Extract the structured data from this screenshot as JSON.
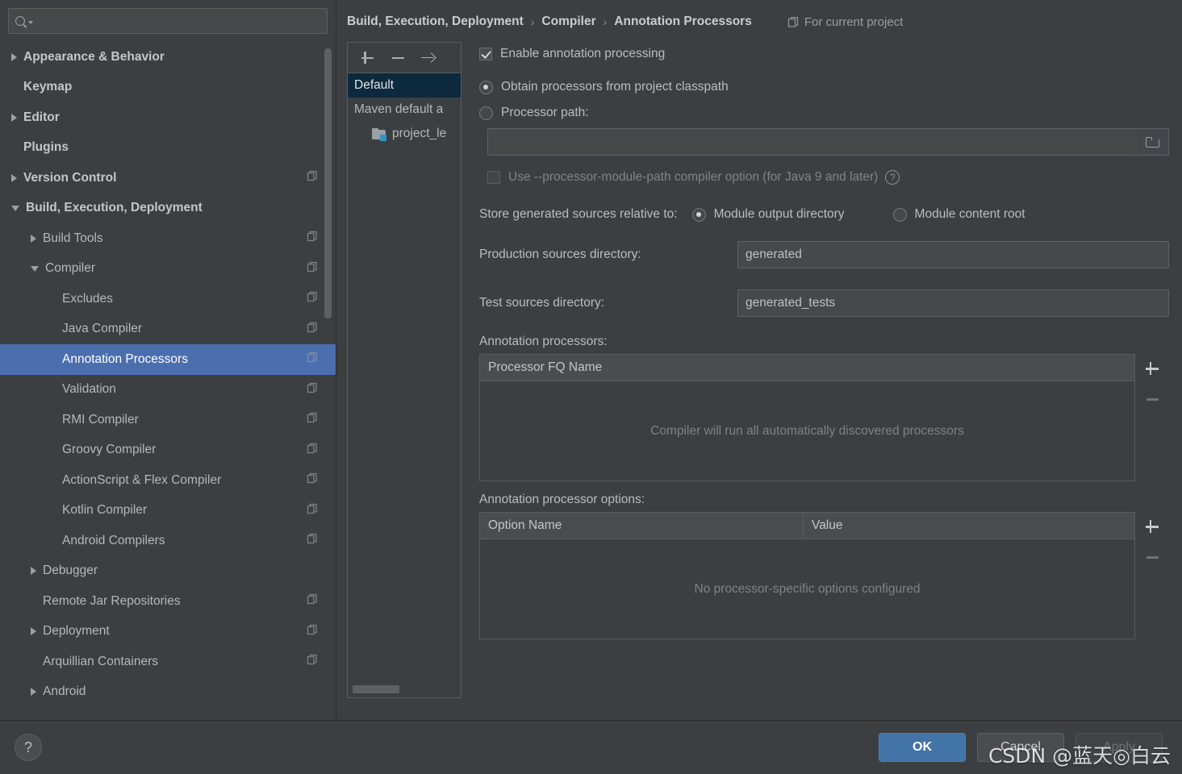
{
  "search": {
    "placeholder": "",
    "value": "",
    "icon": "search-icon"
  },
  "sidebar": {
    "items": [
      {
        "label": "Appearance & Behavior",
        "arrow": "collapsed",
        "bold": true,
        "indent": 0,
        "badge": false,
        "selected": false
      },
      {
        "label": "Keymap",
        "arrow": "none",
        "bold": true,
        "indent": 0,
        "badge": false,
        "selected": false
      },
      {
        "label": "Editor",
        "arrow": "collapsed",
        "bold": true,
        "indent": 0,
        "badge": false,
        "selected": false
      },
      {
        "label": "Plugins",
        "arrow": "none",
        "bold": true,
        "indent": 0,
        "badge": false,
        "selected": false
      },
      {
        "label": "Version Control",
        "arrow": "collapsed",
        "bold": true,
        "indent": 0,
        "badge": true,
        "selected": false
      },
      {
        "label": "Build, Execution, Deployment",
        "arrow": "expanded",
        "bold": true,
        "indent": 0,
        "badge": false,
        "selected": false
      },
      {
        "label": "Build Tools",
        "arrow": "collapsed",
        "bold": false,
        "indent": 1,
        "badge": true,
        "selected": false
      },
      {
        "label": "Compiler",
        "arrow": "expanded",
        "bold": false,
        "indent": 1,
        "badge": true,
        "selected": false
      },
      {
        "label": "Excludes",
        "arrow": "none",
        "bold": false,
        "indent": 2,
        "badge": true,
        "selected": false
      },
      {
        "label": "Java Compiler",
        "arrow": "none",
        "bold": false,
        "indent": 2,
        "badge": true,
        "selected": false
      },
      {
        "label": "Annotation Processors",
        "arrow": "none",
        "bold": false,
        "indent": 2,
        "badge": true,
        "selected": true
      },
      {
        "label": "Validation",
        "arrow": "none",
        "bold": false,
        "indent": 2,
        "badge": true,
        "selected": false
      },
      {
        "label": "RMI Compiler",
        "arrow": "none",
        "bold": false,
        "indent": 2,
        "badge": true,
        "selected": false
      },
      {
        "label": "Groovy Compiler",
        "arrow": "none",
        "bold": false,
        "indent": 2,
        "badge": true,
        "selected": false
      },
      {
        "label": "ActionScript & Flex Compiler",
        "arrow": "none",
        "bold": false,
        "indent": 2,
        "badge": true,
        "selected": false
      },
      {
        "label": "Kotlin Compiler",
        "arrow": "none",
        "bold": false,
        "indent": 2,
        "badge": true,
        "selected": false
      },
      {
        "label": "Android Compilers",
        "arrow": "none",
        "bold": false,
        "indent": 2,
        "badge": true,
        "selected": false
      },
      {
        "label": "Debugger",
        "arrow": "collapsed",
        "bold": false,
        "indent": 1,
        "badge": false,
        "selected": false
      },
      {
        "label": "Remote Jar Repositories",
        "arrow": "none",
        "bold": false,
        "indent": 1,
        "badge": true,
        "selected": false
      },
      {
        "label": "Deployment",
        "arrow": "collapsed",
        "bold": false,
        "indent": 1,
        "badge": true,
        "selected": false
      },
      {
        "label": "Arquillian Containers",
        "arrow": "none",
        "bold": false,
        "indent": 1,
        "badge": true,
        "selected": false
      },
      {
        "label": "Android",
        "arrow": "collapsed",
        "bold": false,
        "indent": 1,
        "badge": false,
        "selected": false
      }
    ]
  },
  "header": {
    "breadcrumb": [
      "Build, Execution, Deployment",
      "Compiler",
      "Annotation Processors"
    ],
    "separator": "›",
    "scope_badge": "For current project"
  },
  "profiles": {
    "toolbar": {
      "add": "+",
      "remove": "−",
      "move": "→"
    },
    "items": [
      {
        "label": "Default",
        "selected": true,
        "module": false
      },
      {
        "label": "Maven default a",
        "selected": false,
        "module": false
      },
      {
        "label": "project_le",
        "selected": false,
        "module": true
      }
    ]
  },
  "settings": {
    "enable_annotation_processing": {
      "label": "Enable annotation processing",
      "checked": true
    },
    "source_mode": {
      "obtain_from_classpath": {
        "label": "Obtain processors from project classpath",
        "selected": true
      },
      "processor_path": {
        "label": "Processor path:",
        "selected": false,
        "value": "",
        "browse_icon": "folder-icon"
      }
    },
    "processor_module_path": {
      "label": "Use --processor-module-path compiler option (for Java 9 and later)",
      "checked": false,
      "disabled": true,
      "help_icon": "help-icon"
    },
    "store_relative_to": {
      "label": "Store generated sources relative to:",
      "options": [
        {
          "label": "Module output directory",
          "selected": true
        },
        {
          "label": "Module content root",
          "selected": false
        }
      ]
    },
    "production_sources": {
      "label": "Production sources directory:",
      "value": "generated"
    },
    "test_sources": {
      "label": "Test sources directory:",
      "value": "generated_tests"
    },
    "processors_table": {
      "title": "Annotation processors:",
      "columns": [
        "Processor FQ Name"
      ],
      "rows": [],
      "empty_text": "Compiler will run all automatically discovered processors",
      "add_label": "+",
      "remove_label": "−"
    },
    "options_table": {
      "title": "Annotation processor options:",
      "columns": [
        "Option Name",
        "Value"
      ],
      "rows": [],
      "empty_text": "No processor-specific options configured",
      "add_label": "+",
      "remove_label": "−"
    }
  },
  "footer": {
    "help_label": "?",
    "ok": "OK",
    "cancel": "Cancel",
    "apply": "Apply"
  },
  "watermark": "CSDN @蓝天◎白云",
  "colors": {
    "selection_blue": "#4b6eaf",
    "primary_button": "#4274a8",
    "profile_selection": "#0d293e",
    "module_badge": "#3592c4",
    "background": "#3c3f41"
  }
}
